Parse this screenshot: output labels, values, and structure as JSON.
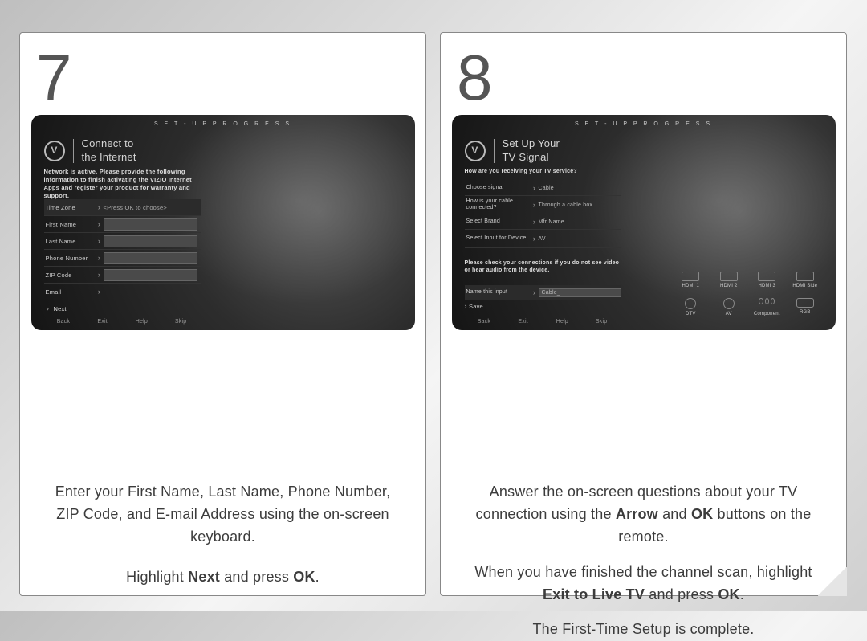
{
  "step7": {
    "num": "7",
    "screen": {
      "progress": "S E T - U P   P R O G R E S S",
      "title1": "Connect to",
      "title2": "the Internet",
      "desc": "Network is active. Please provide the following information to finish activating the VIZIO Internet Apps and register your product for warranty and support.",
      "rows": [
        {
          "label": "Time Zone",
          "val": "<Press OK to choose>",
          "hl": true
        },
        {
          "label": "First Name",
          "input": true
        },
        {
          "label": "Last Name",
          "input": true
        },
        {
          "label": "Phone Number",
          "input": true
        },
        {
          "label": "ZIP Code",
          "input": true
        },
        {
          "label": "Email",
          "arrowOnly": true
        }
      ],
      "next": "Next",
      "bottom": [
        "Back",
        "Exit",
        "Help",
        "Skip"
      ]
    },
    "inst1": "Enter your First Name, Last Name, Phone Number, ZIP Code, and E-mail Address using the on-screen keyboard.",
    "inst2_a": "Highlight ",
    "inst2_b": "Next",
    "inst2_c": " and press ",
    "inst2_d": "OK",
    "inst2_e": "."
  },
  "step8": {
    "num": "8",
    "screen": {
      "progress": "S E T - U P   P R O G R E S S",
      "title1": "Set Up Your",
      "title2": "TV Signal",
      "q": "How are you receiving your TV service?",
      "rows": [
        {
          "label": "Choose signal",
          "val": "Cable"
        },
        {
          "label": "How is your cable connected?",
          "val": "Through a cable box"
        },
        {
          "label": "Select Brand",
          "val": "Mfr Name"
        },
        {
          "label": "Select Input for Device",
          "val": "AV"
        }
      ],
      "note": "Please check your connections if you do not see video or hear audio from the device.",
      "nameLabel": "Name this input",
      "nameVal": "Cable_",
      "save": "Save",
      "bottom": [
        "Back",
        "Exit",
        "Help",
        "Skip"
      ],
      "ports": [
        "HDMI 1",
        "HDMI 2",
        "HDMI 3",
        "HDMI Side",
        "DTV",
        "AV",
        "Component",
        "RGB"
      ]
    },
    "inst1_a": "Answer the on-screen questions about your TV connection using the ",
    "inst1_b": "Arrow",
    "inst1_c": " and ",
    "inst1_d": "OK",
    "inst1_e": " buttons on the remote.",
    "inst2_a": "When you have finished the channel scan, highlight ",
    "inst2_b": "Exit to Live TV",
    "inst2_c": " and press ",
    "inst2_d": "OK",
    "inst2_e": ".",
    "inst3": "The First-Time Setup is complete."
  }
}
